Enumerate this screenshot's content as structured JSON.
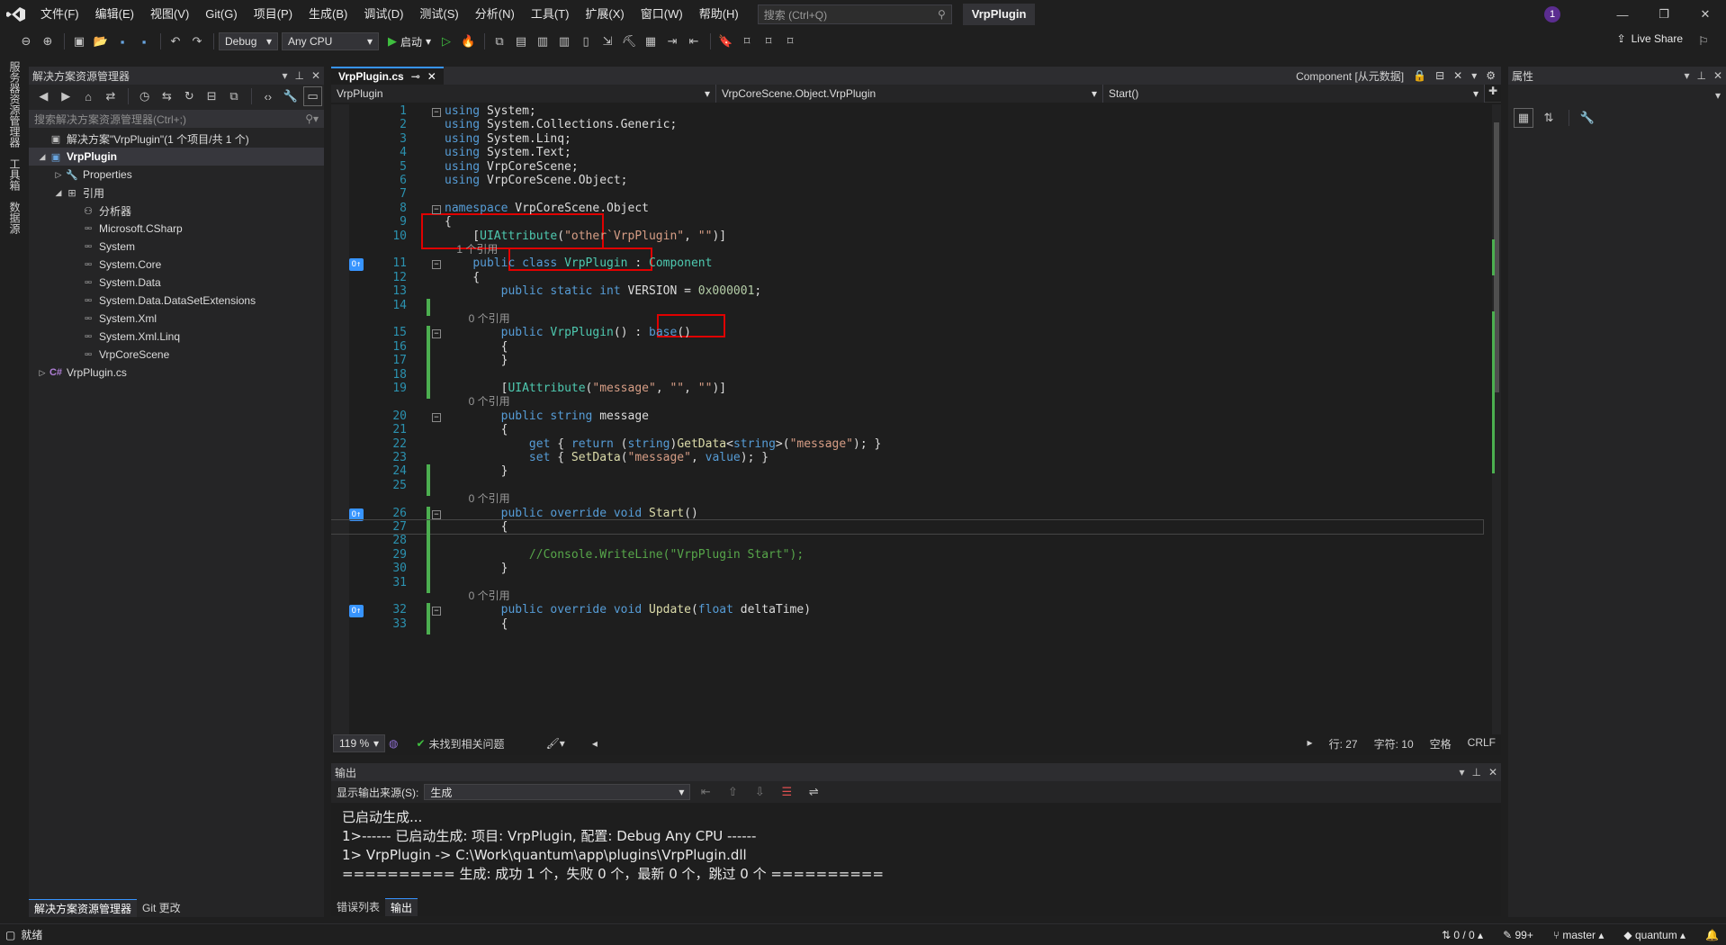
{
  "menu": [
    "文件(F)",
    "编辑(E)",
    "视图(V)",
    "Git(G)",
    "项目(P)",
    "生成(B)",
    "调试(D)",
    "测试(S)",
    "分析(N)",
    "工具(T)",
    "扩展(X)",
    "窗口(W)",
    "帮助(H)"
  ],
  "search": {
    "placeholder": "搜索 (Ctrl+Q)"
  },
  "project_title": "VrpPlugin",
  "account_badge": "1",
  "toolbar": {
    "config": "Debug",
    "platform": "Any CPU",
    "run_label": "启动",
    "live_share": "Live Share"
  },
  "side_tabs": [
    "服务器资源管理器",
    "工具箱",
    "数据源"
  ],
  "solution_explorer": {
    "title": "解决方案资源管理器",
    "search_placeholder": "搜索解决方案资源管理器(Ctrl+;)",
    "tree": [
      {
        "label": "解决方案\"VrpPlugin\"(1 个项目/共 1 个)",
        "icon": "solution-icon",
        "indent": 0,
        "arrow": ""
      },
      {
        "label": "VrpPlugin",
        "icon": "project-icon",
        "indent": 0,
        "arrow": "◢",
        "bold": true,
        "selected": true
      },
      {
        "label": "Properties",
        "icon": "wrench-icon",
        "indent": 1,
        "arrow": "▷"
      },
      {
        "label": "引用",
        "icon": "references-icon",
        "indent": 1,
        "arrow": "◢"
      },
      {
        "label": "分析器",
        "icon": "analyzer-icon",
        "indent": 2,
        "arrow": ""
      },
      {
        "label": "Microsoft.CSharp",
        "icon": "reference-icon",
        "indent": 2,
        "arrow": ""
      },
      {
        "label": "System",
        "icon": "reference-icon",
        "indent": 2,
        "arrow": ""
      },
      {
        "label": "System.Core",
        "icon": "reference-icon",
        "indent": 2,
        "arrow": ""
      },
      {
        "label": "System.Data",
        "icon": "reference-icon",
        "indent": 2,
        "arrow": ""
      },
      {
        "label": "System.Data.DataSetExtensions",
        "icon": "reference-icon",
        "indent": 2,
        "arrow": ""
      },
      {
        "label": "System.Xml",
        "icon": "reference-icon",
        "indent": 2,
        "arrow": ""
      },
      {
        "label": "System.Xml.Linq",
        "icon": "reference-icon",
        "indent": 2,
        "arrow": ""
      },
      {
        "label": "VrpCoreScene",
        "icon": "reference-icon",
        "indent": 2,
        "arrow": ""
      },
      {
        "label": "VrpPlugin.cs",
        "icon": "csharp-file-icon",
        "indent": 0,
        "arrow": "▷"
      }
    ],
    "bottom_tabs": [
      "解决方案资源管理器",
      "Git 更改"
    ]
  },
  "editor": {
    "tab_label": "VrpPlugin.cs",
    "preview": "Component [从元数据]",
    "nav": [
      "VrpPlugin",
      "VrpCoreScene.Object.VrpPlugin",
      "Start()"
    ],
    "lines": [
      {
        "n": "1",
        "fold": "⊟",
        "html": "<span class=\"kw\">using</span> System;"
      },
      {
        "n": "2",
        "html": "<span class=\"kw\">using</span> System.Collections.Generic;"
      },
      {
        "n": "3",
        "html": "<span class=\"kw\">using</span> System.Linq;"
      },
      {
        "n": "4",
        "html": "<span class=\"kw\">using</span> System.Text;"
      },
      {
        "n": "5",
        "html": "<span class=\"kw\">using</span> VrpCoreScene;"
      },
      {
        "n": "6",
        "html": "<span class=\"kw\">using</span> VrpCoreScene.Object;"
      },
      {
        "n": "7",
        "html": ""
      },
      {
        "n": "8",
        "fold": "⊟",
        "html": "<span class=\"kw\">namespace</span> VrpCoreScene.Object"
      },
      {
        "n": "9",
        "html": "{"
      },
      {
        "n": "10",
        "html": "    [<span class=\"ty\">UIAttribute</span>(<span class=\"str\">\"other`VrpPlugin\"</span>, <span class=\"str\">\"\"</span>)]"
      },
      {
        "n": "",
        "lens": "    1 个引用"
      },
      {
        "n": "11",
        "fold": "⊟",
        "mark": true,
        "html": "    <span class=\"kw\">public class</span> <span class=\"ty\">VrpPlugin</span> : <span class=\"ty\">Component</span>"
      },
      {
        "n": "12",
        "html": "    {"
      },
      {
        "n": "13",
        "html": "        <span class=\"kw\">public static int</span> VERSION = <span class=\"nm\">0x000001</span>;"
      },
      {
        "n": "14",
        "change": true,
        "html": ""
      },
      {
        "n": "",
        "lens": "        0 个引用"
      },
      {
        "n": "15",
        "fold": "⊟",
        "change": true,
        "html": "        <span class=\"kw\">public</span> <span class=\"ty\">VrpPlugin</span>() : <span class=\"kw\">base</span>()"
      },
      {
        "n": "16",
        "change": true,
        "html": "        {"
      },
      {
        "n": "17",
        "change": true,
        "html": "        }"
      },
      {
        "n": "18",
        "change": true,
        "html": ""
      },
      {
        "n": "19",
        "change": true,
        "html": "        [<span class=\"ty\">UIAttribute</span>(<span class=\"str\">\"message\"</span>, <span class=\"str\">\"\"</span>, <span class=\"str\">\"\"</span>)]"
      },
      {
        "n": "",
        "lens": "        0 个引用"
      },
      {
        "n": "20",
        "fold": "⊟",
        "html": "        <span class=\"kw\">public string</span> message"
      },
      {
        "n": "21",
        "html": "        {"
      },
      {
        "n": "22",
        "html": "            <span class=\"kw\">get</span> { <span class=\"kw\">return</span> (<span class=\"kw\">string</span>)<span class=\"fn\">GetData</span>&lt;<span class=\"kw\">string</span>&gt;(<span class=\"str\">\"message\"</span>); }"
      },
      {
        "n": "23",
        "html": "            <span class=\"kw\">set</span> { <span class=\"fn\">SetData</span>(<span class=\"str\">\"message\"</span>, <span class=\"kw\">value</span>); }"
      },
      {
        "n": "24",
        "change": true,
        "html": "        }"
      },
      {
        "n": "25",
        "change": true,
        "html": ""
      },
      {
        "n": "",
        "lens": "        0 个引用"
      },
      {
        "n": "26",
        "fold": "⊟",
        "mark": true,
        "change": true,
        "html": "        <span class=\"kw\">public override void</span> <span class=\"fn\">Start</span>()"
      },
      {
        "n": "27",
        "change": true,
        "current": true,
        "html": "        {"
      },
      {
        "n": "28",
        "change": true,
        "html": ""
      },
      {
        "n": "29",
        "change": true,
        "html": "            <span class=\"cm\">//Console.WriteLine(\"VrpPlugin Start\");</span>"
      },
      {
        "n": "30",
        "change": true,
        "html": "        }"
      },
      {
        "n": "31",
        "change": true,
        "html": ""
      },
      {
        "n": "",
        "lens": "        0 个引用"
      },
      {
        "n": "32",
        "fold": "⊟",
        "mark": true,
        "change": true,
        "html": "        <span class=\"kw\">public override void</span> <span class=\"fn\">Update</span>(<span class=\"kw\">float</span> deltaTime)"
      },
      {
        "n": "33",
        "change": true,
        "html": "        {"
      }
    ],
    "status": {
      "zoom": "119 %",
      "issues": "未找到相关问题",
      "line": "行: 27",
      "col": "字符: 10",
      "spacing": "空格",
      "eol": "CRLF"
    }
  },
  "properties_panel": {
    "title": "属性"
  },
  "output_panel": {
    "title": "输出",
    "source_label": "显示输出来源(S):",
    "source_value": "生成",
    "lines": [
      "已启动生成...",
      "1>------ 已启动生成: 项目: VrpPlugin, 配置: Debug Any CPU ------",
      "1>  VrpPlugin -> C:\\Work\\quantum\\app\\plugins\\VrpPlugin.dll",
      "========== 生成: 成功 1 个，失败 0 个，最新 0 个，跳过 0 个 =========="
    ],
    "tabs": [
      "错误列表",
      "输出"
    ]
  },
  "statusbar": {
    "ready": "就绪",
    "changes": "0 / 0",
    "edits": "99+",
    "branch": "master",
    "repo": "quantum"
  }
}
